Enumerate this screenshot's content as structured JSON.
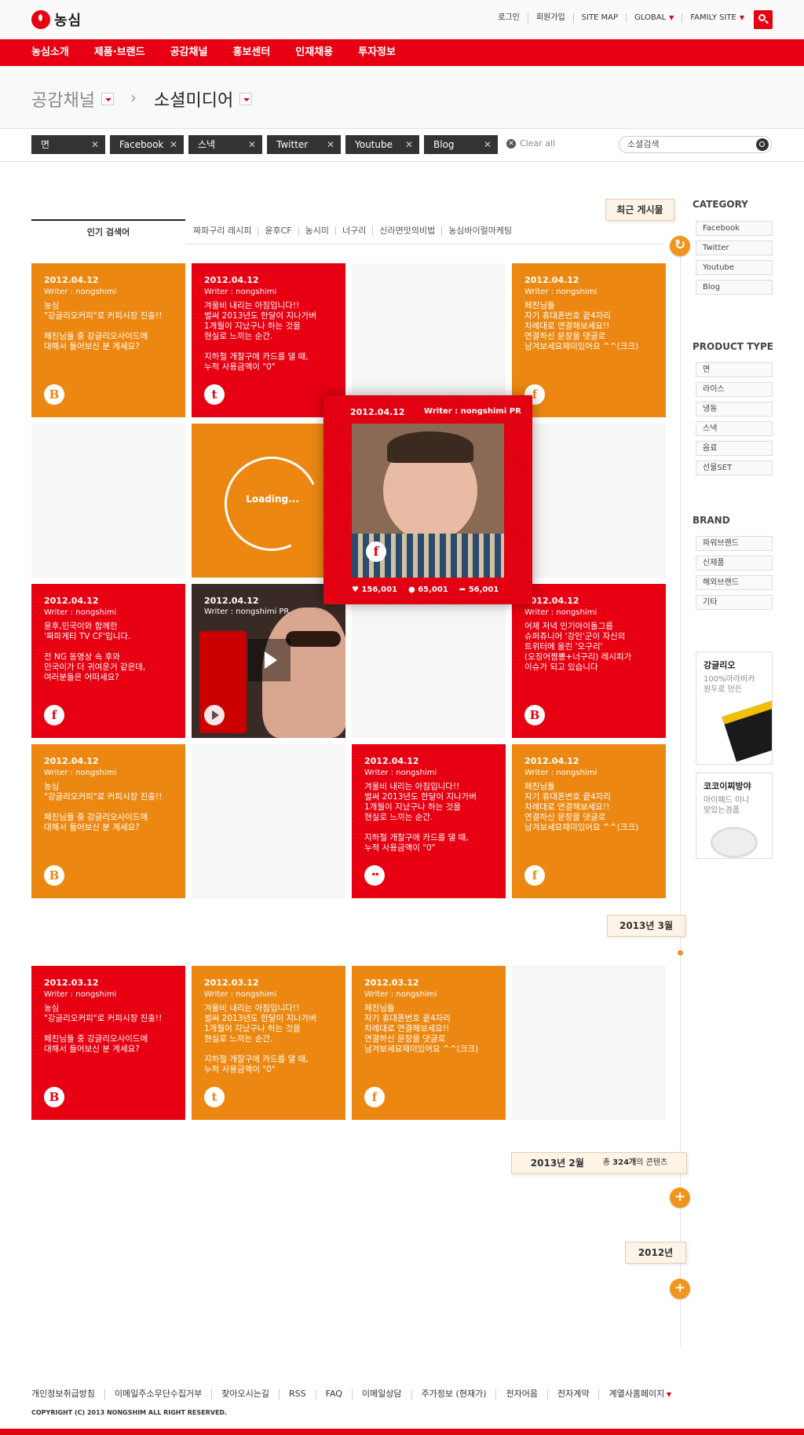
{
  "header": {
    "logo_text": "농심",
    "util_links": [
      "로그인",
      "회원가입",
      "SITE MAP",
      "GLOBAL",
      "FAMILY SITE"
    ],
    "gnb": [
      "농심소개",
      "제품·브랜드",
      "공감채널",
      "홍보센터",
      "인재채용",
      "투자정보"
    ]
  },
  "location": {
    "level1": "공감채널",
    "sep": "›",
    "level2": "소셜미디어"
  },
  "filters": {
    "chips": [
      "면",
      "Facebook",
      "스낵",
      "Twitter",
      "Youtube",
      "Blog"
    ],
    "clear_all": "Clear all",
    "search_placeholder": "소셜검색"
  },
  "popular": {
    "tab": "인기 검색어",
    "keywords": [
      "짜파구리 레시피",
      "윤후CF",
      "농시미",
      "너구리",
      "신라면맛의비법",
      "농심바이럴마케팅"
    ]
  },
  "timeline": {
    "recent": "최근 게시물",
    "march": "2013년 3월",
    "feb": "2013년 2월",
    "feb_count_prefix": "총",
    "feb_count": "324개",
    "feb_count_suffix": "의 콘텐츠",
    "y2012": "2012년",
    "refresh_glyph": "↻",
    "plus_glyph": "+"
  },
  "tiles": [
    {
      "date": "2012.04.12",
      "writer": "Writer : nongshimi",
      "text": "농심\n\"강글리오커피\"로 커피시장 진출!!\n\n페친님들 중 강글리오사이드에\n대해서 들어보신 분 계세요?",
      "sns": "B",
      "sns_icon": "blog-icon"
    },
    {
      "date": "2012.04.12",
      "writer": "Writer : nongshimi",
      "text": "겨울비 내리는 아침입니다!!\n벌써 2013년도 한달이 지나가버\n1개월이 지났구나 하는 것을\n현실로 느끼는 순간.\n\n지하철 개찰구에 카드를 댈 때,\n누적 사용금액이 \"0\"",
      "sns": "t",
      "sns_icon": "twitter-icon"
    },
    {
      "date": "2012.04.12",
      "writer": "Writer : nongshimi",
      "text": "페친님들\n자기 휴대폰번호 끝4자리\n차례대로 연결해보세요!!\n연결하신 문장을 댓글로\n남겨보세요재미있어요 ^^(크크)",
      "sns": "f",
      "sns_icon": "facebook-icon"
    },
    {
      "loading": "Loading..."
    },
    {
      "date": "2012.04.12",
      "writer": "Writer : nongshimi",
      "text": "윤후,민국이와 함께한\n'짜파게티 TV CF'입니다.\n\n전 NG 동영상 속 후와\n민국이가 더 귀여운거 같은데,\n여러분들은 어떠세요?",
      "sns": "f",
      "sns_icon": "facebook-icon"
    },
    {
      "date": "2012.04.12",
      "writer": "Writer : nongshimi PR"
    },
    {
      "date": "2012.04.12",
      "writer": "Writer : nongshimi",
      "text": "어제 저녁 인기아이돌그룹\n슈퍼쥬니어 '강인'군이 자신의\n트위터에 올린 '오구리'\n(오징어짬뽕+너구리) 레시피가\n이슈가 되고 있습니다",
      "sns": "B",
      "sns_icon": "blog-icon"
    },
    {
      "date": "2012.04.12",
      "writer": "Writer : nongshimi",
      "text": "농심\n\"강글리오커피\"로 커피시장 진출!!\n\n페친님들 중 강글리오사이드에\n대해서 들어보신 분 계세요?",
      "sns": "B",
      "sns_icon": "blog-icon"
    },
    {
      "date": "2012.04.12",
      "writer": "Writer : nongshimi",
      "text": "겨울비 내리는 아침입니다!!\n벌써 2013년도 한달이 지나가버\n1개월이 지났구나 하는 것을\n현실로 느끼는 순간.\n\n지하철 개찰구에 카드를 댈 때,\n누적 사용금액이 \"0\"",
      "sns": "••",
      "sns_icon": "flickr-icon"
    },
    {
      "date": "2012.04.12",
      "writer": "Writer : nongshimi",
      "text": "페친님들\n자기 휴대폰번호 끝4자리\n차례대로 연결해보세요!!\n연결하신 문장을 댓글로\n남겨보세요재미있어요 ^^(크크)",
      "sns": "f",
      "sns_icon": "facebook-icon"
    },
    {
      "date": "2012.03.12",
      "writer": "Writer : nongshimi",
      "text": "농심\n\"강글리오커피\"로 커피시장 진출!!\n\n페친님들 중 강글리오사이드에\n대해서 들어보신 분 계세요?",
      "sns": "B",
      "sns_icon": "blog-icon"
    },
    {
      "date": "2012.03.12",
      "writer": "Writer : nongshimi",
      "text": "겨울비 내리는 아침입니다!!\n벌써 2013년도 한달이 지나가버\n1개월이 지났구나 하는 것을\n현실로 느끼는 순간.\n\n지하철 개찰구에 카드를 댈 때,\n누적 사용금액이 \"0\"",
      "sns": "t",
      "sns_icon": "twitter-icon"
    },
    {
      "date": "2012.03.12",
      "writer": "Writer : nongshimi",
      "text": "페친님들\n자기 휴대폰번호 끝4자리\n차례대로 연결해보세요!!\n연결하신 문장을 댓글로\n남겨보세요재미있어요 ^^(크크)",
      "sns": "f",
      "sns_icon": "facebook-icon"
    }
  ],
  "popup": {
    "date": "2012.04.12",
    "writer": "Writer : nongshimi PR",
    "likes": "156,001",
    "comments": "65,001",
    "shares": "56,001"
  },
  "sidebar": {
    "category_title": "CATEGORY",
    "category": [
      "Facebook",
      "Twitter",
      "Youtube",
      "Blog"
    ],
    "product_title": "PRODUCT TYPE",
    "product": [
      "면",
      "라이스",
      "냉동",
      "스낵",
      "음료",
      "선물SET"
    ],
    "brand_title": "BRAND",
    "brand": [
      "파워브랜드",
      "신제품",
      "해외브랜드",
      "기타"
    ],
    "banner1": {
      "title": "강글리오",
      "sub": "100%아라비카\n원두로 만든"
    },
    "banner2": {
      "title": "코코이찌방야",
      "sub": "아이패드 미니\n맞있는경품"
    }
  },
  "footer": {
    "links": [
      "개인정보취급방침",
      "이메일주소무단수집거부",
      "찾아오시는길",
      "RSS",
      "FAQ",
      "이메일상담",
      "주가정보 (현재가)",
      "전자어음",
      "전자계약",
      "계열사홈페이지"
    ],
    "copyright": "COPYRIGHT (C) 2013 NONGSHIM ALL RIGHT RESERVED."
  },
  "colors": {
    "brand_red": "#e60012",
    "orange": "#ec8812"
  }
}
